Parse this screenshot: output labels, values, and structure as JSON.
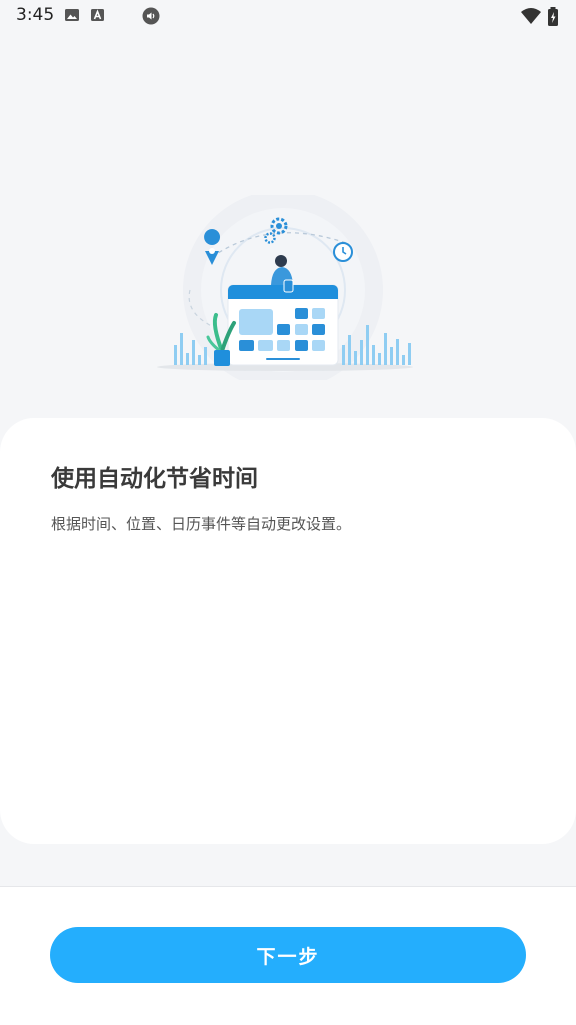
{
  "status_bar": {
    "time": "3:45",
    "left_icons": [
      "image-icon",
      "a-letter-icon",
      "volume-circle-icon"
    ],
    "right_icons": [
      "wifi-icon",
      "battery-icon"
    ]
  },
  "hero": {
    "icon": "automation-illustration",
    "accent_color": "#2a8fd8"
  },
  "card": {
    "title": "使用自动化节省时间",
    "description": "根据时间、位置、日历事件等自动更改设置。"
  },
  "footer": {
    "next_button_label": "下一步",
    "button_color": "#24aefd"
  }
}
